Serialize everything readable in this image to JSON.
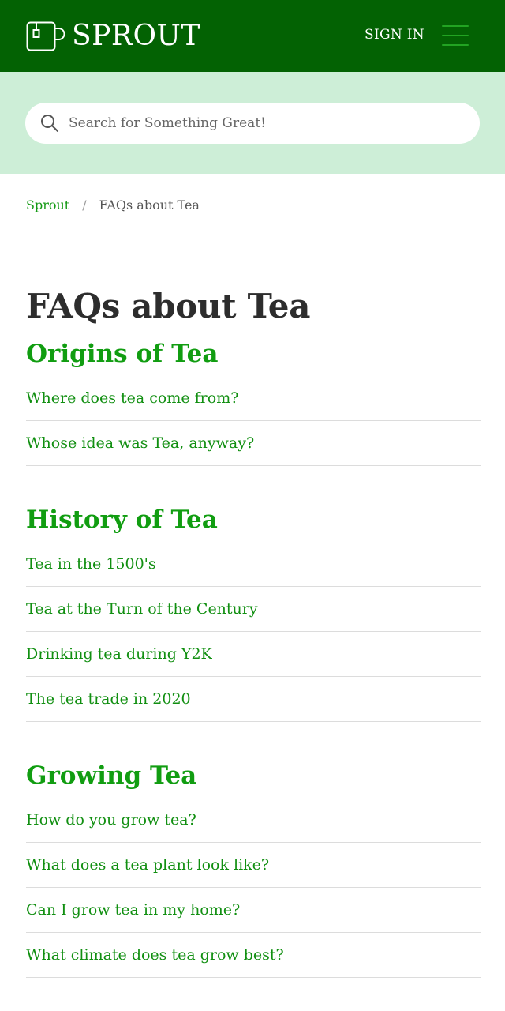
{
  "header": {
    "brand": "SPROUT",
    "sign_in": "SIGN IN",
    "colors": {
      "background": "#036203",
      "menu_icon": "#22a422"
    }
  },
  "search": {
    "placeholder": "Search for Something Great!",
    "band_color": "#cdeed7"
  },
  "breadcrumb": {
    "home": "Sprout",
    "separator": "/",
    "current": "FAQs about Tea"
  },
  "page": {
    "title": "FAQs about Tea"
  },
  "sections": [
    {
      "heading": "Origins of Tea",
      "articles": [
        "Where does tea come from?",
        "Whose idea was Tea, anyway?"
      ]
    },
    {
      "heading": "History of Tea",
      "articles": [
        "Tea in the 1500's",
        "Tea at the Turn of the Century",
        "Drinking tea during Y2K",
        "The tea trade in 2020"
      ]
    },
    {
      "heading": "Growing Tea",
      "articles": [
        "How do you grow tea?",
        "What does a tea plant look like?",
        "Can I grow tea in my home?",
        "What climate does tea grow best?"
      ]
    }
  ],
  "icons": {
    "brand": "teacup-icon",
    "search": "search-icon",
    "menu": "hamburger-menu-icon"
  }
}
